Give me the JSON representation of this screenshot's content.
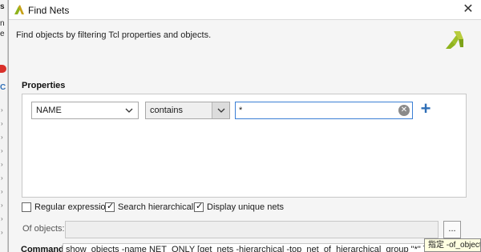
{
  "background": {
    "fragments": [
      "s",
      "n",
      "e",
      "C"
    ],
    "accent_colors": {
      "badge": "#d9302a"
    }
  },
  "dialog": {
    "title": "Find Nets",
    "close_icon": "✕",
    "description": "Find objects by filtering Tcl properties and objects.",
    "properties_label": "Properties",
    "filter_row": {
      "property": "NAME",
      "operator": "contains",
      "value": "*"
    },
    "options": {
      "regular_expression": {
        "label": "Regular expression",
        "checked": false
      },
      "search_hierarchically": {
        "label": "Search hierarchically",
        "checked": true
      },
      "display_unique_nets": {
        "label": "Display unique nets",
        "checked": true
      }
    },
    "of_objects_label": "Of objects:",
    "of_objects_value": "",
    "browse_label": "...",
    "command_label": "Command:",
    "command_value": "show_objects -name NET_ONLY [get_nets -hierarchical -top_net_of_hierarchical_group \"*\" ]",
    "tooltip": "指定 -of_objects"
  },
  "colors": {
    "accent": "#2f6fb7",
    "focus_border": "#3b7fd5",
    "logo_green": "#8fb31d"
  }
}
